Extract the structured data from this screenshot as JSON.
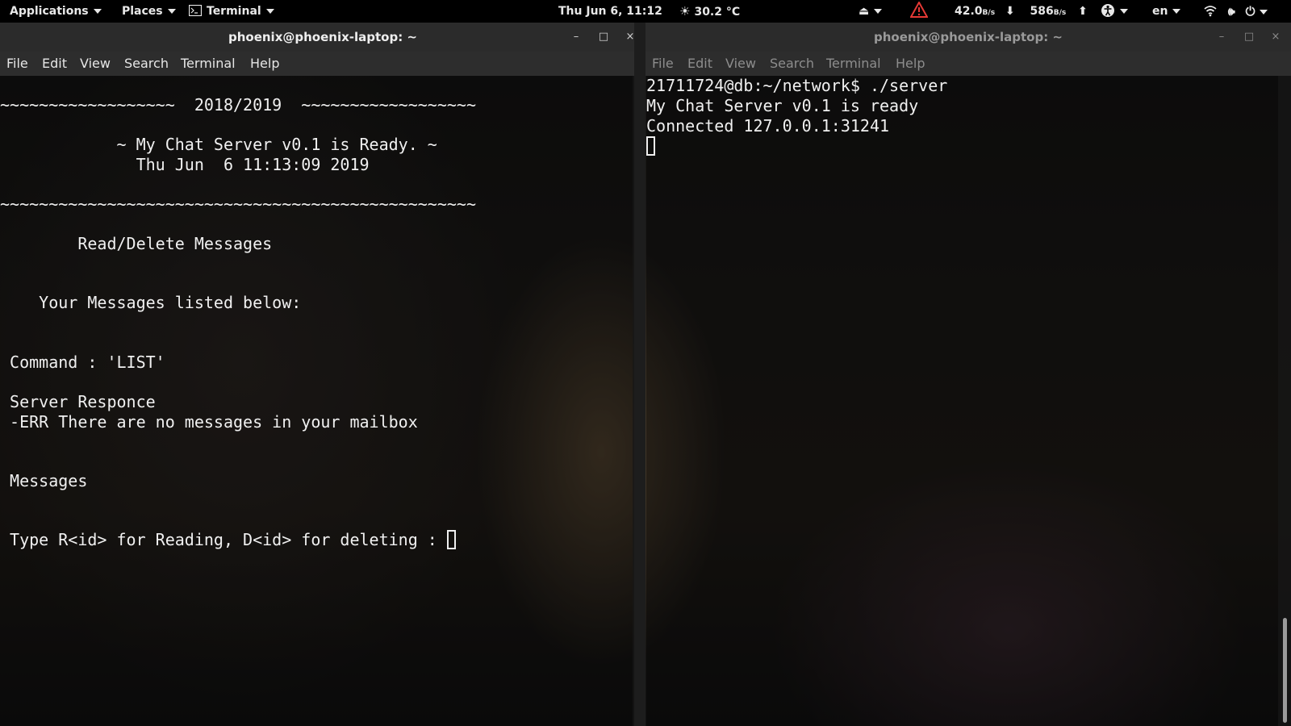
{
  "panel": {
    "applications": "Applications",
    "places": "Places",
    "terminal": "Terminal",
    "clock": "Thu Jun  6, 11:12",
    "temperature": "30.2 °C",
    "download_value": "42.0",
    "download_unit": "B/s",
    "upload_value": "586",
    "upload_unit": "B/s",
    "language": "en"
  },
  "left_window": {
    "title": "phoenix@phoenix-laptop: ~",
    "menu": [
      "File",
      "Edit",
      "View",
      "Search",
      "Terminal",
      "Help"
    ],
    "lines": [
      "~~~~~~~~~~~~~~~~~~  2018/2019  ~~~~~~~~~~~~~~~~~~",
      "            ~ My Chat Server v0.1 is Ready. ~",
      "              Thu Jun  6 11:13:09 2019",
      "~~~~~~~~~~~~~~~~~~~~~~~~~~~~~~~~~~~~~~~~~~~~~~~~~",
      "        Read/Delete Messages",
      "    Your Messages listed below:",
      " Command : 'LIST'",
      " Server Responce",
      " -ERR There are no messages in your mailbox",
      " Messages",
      " Type R<id> for Reading, D<id> for deleting : "
    ]
  },
  "right_window": {
    "title": "phoenix@phoenix-laptop: ~",
    "menu": [
      "File",
      "Edit",
      "View",
      "Search",
      "Terminal",
      "Help"
    ],
    "lines": [
      "21711724@db:~/network$ ./server",
      "My Chat Server v0.1 is ready",
      "Connected 127.0.0.1:31241"
    ]
  },
  "colors": {
    "panel_bg": "#000000",
    "titlebar_bg": "#2b2b2b",
    "warning": "#e53935"
  }
}
